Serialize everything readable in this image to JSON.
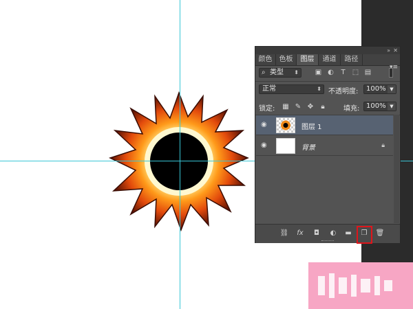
{
  "panel": {
    "tabs": [
      "颜色",
      "色板",
      "图层",
      "通道",
      "路径"
    ],
    "active_tab": "图层",
    "menu_icon": "panel-menu-icon",
    "filter": {
      "kind_label": "类型"
    },
    "blend_mode": "正常",
    "opacity_label": "不透明度:",
    "opacity_value": "100%",
    "lock_label": "锁定:",
    "fill_label": "填充:",
    "fill_value": "100%",
    "layers": [
      {
        "name": "图层 1",
        "selected": true,
        "visible": true
      },
      {
        "name": "背景",
        "selected": false,
        "visible": true,
        "locked": true
      }
    ],
    "footer_buttons": [
      "link-layers",
      "fx",
      "add-mask",
      "adjustment-layer",
      "new-group",
      "new-layer",
      "delete-layer"
    ],
    "highlight_color": "#e0151b"
  },
  "colors": {
    "guide": "#39c6d6",
    "panel_bg": "#535353",
    "selected_row": "#576272",
    "watermark": "#f7a6c4"
  }
}
